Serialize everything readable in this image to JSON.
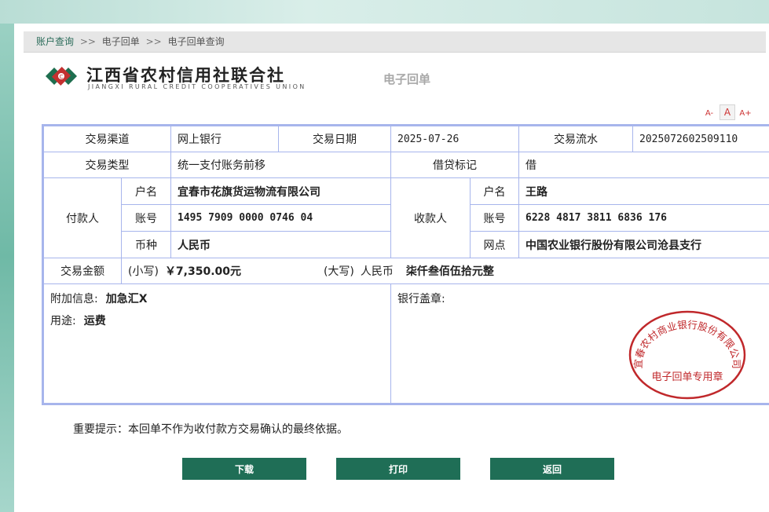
{
  "breadcrumb": [
    "账户查询",
    "电子回单",
    "电子回单查询"
  ],
  "breadcrumb_sep": ">>",
  "logo": {
    "cn": "江西省农村信用社联合社",
    "en": "JIANGXI RURAL CREDIT COOPERATIVES UNION"
  },
  "page_subtitle": "电子回单",
  "font_controls": [
    "A-",
    "A",
    "A+"
  ],
  "receipt": {
    "channel_label": "交易渠道",
    "channel": "网上银行",
    "date_label": "交易日期",
    "date": "2025-07-26",
    "serial_label": "交易流水",
    "serial": "2025072602509110",
    "type_label": "交易类型",
    "type": "统一支付账务前移",
    "dc_label": "借贷标记",
    "dc": "借",
    "payer_label": "付款人",
    "payee_label": "收款人",
    "name_label": "户名",
    "account_label": "账号",
    "currency_label": "币种",
    "branch_label": "网点",
    "payer_name": "宜春市花旗货运物流有限公司",
    "payer_account": "1495 7909 0000 0746 04",
    "payer_currency": "人民币",
    "payee_name": "王路",
    "payee_account": "6228 4817 3811 6836 176",
    "payee_branch": "中国农业银行股份有限公司沧县支行",
    "amount_label": "交易金额",
    "small_label": "(小写)",
    "small_value": "￥7,350.00元",
    "big_label": "(大写)",
    "big_currency": "人民币",
    "big_value": "柒仟叁佰伍拾元整",
    "extra_label": "附加信息:",
    "extra_value": "加急汇X",
    "purpose_label": "用途:",
    "purpose_value": "运费",
    "stamp_label": "银行盖章:"
  },
  "seal": {
    "ring_text": "宜春农村商业银行股份有限公司",
    "center_text": "电子回单专用章",
    "color": "#c0282b"
  },
  "notice": "重要提示：本回单不作为收付款方交易确认的最终依据。",
  "buttons": {
    "download": "下载",
    "print": "打印",
    "back": "返回"
  },
  "colors": {
    "accent": "#1f6e56",
    "border": "#a7b5ec"
  }
}
